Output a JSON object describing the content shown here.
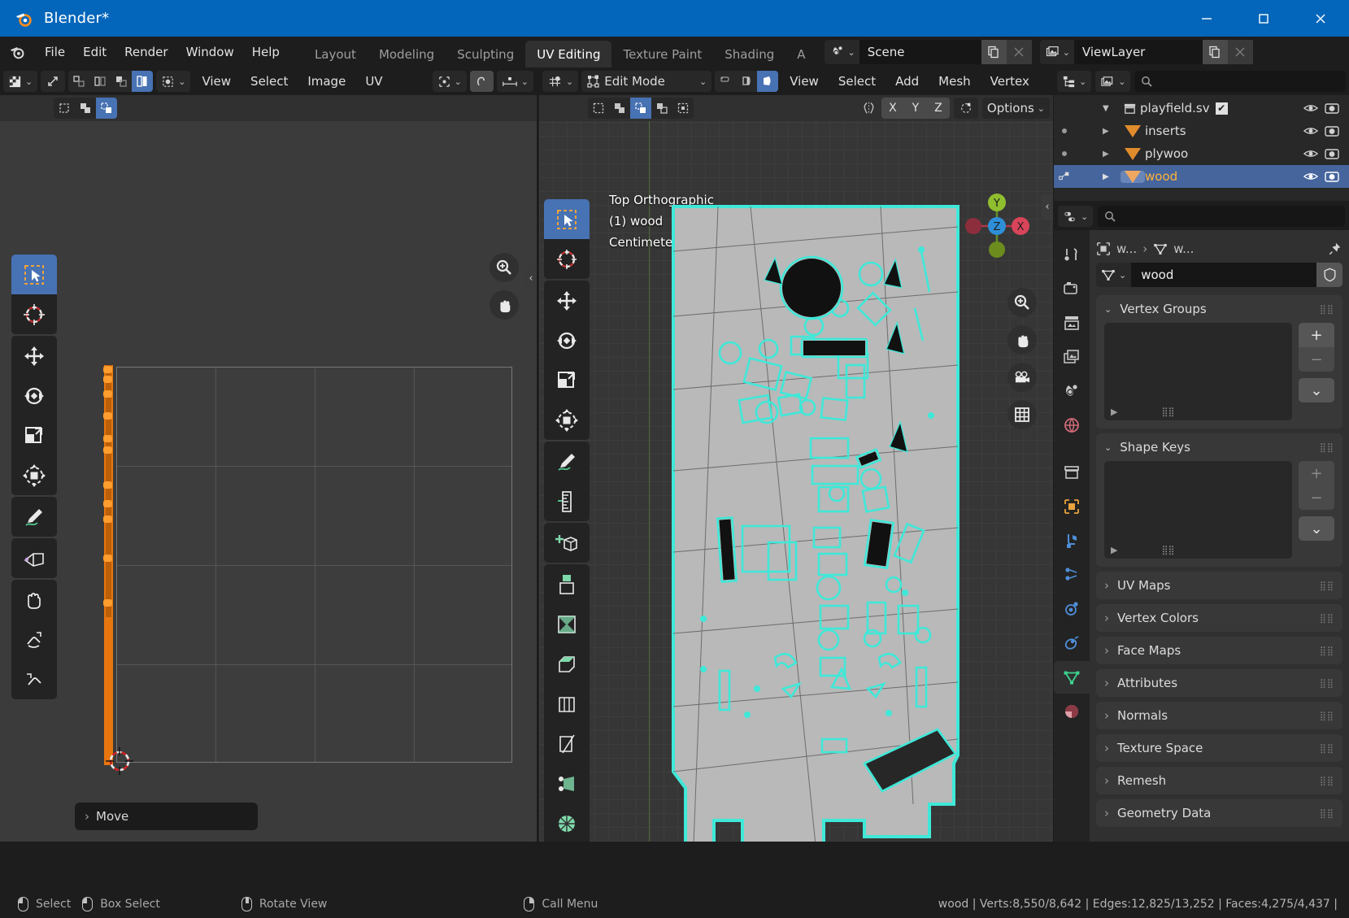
{
  "window": {
    "title": "Blender*",
    "minimize_label": "–",
    "maximize_label": "☐",
    "close_label": "✕"
  },
  "topbar": {
    "menus": [
      "File",
      "Edit",
      "Render",
      "Window",
      "Help"
    ],
    "workspaces": [
      {
        "label": "Layout",
        "active": false
      },
      {
        "label": "Modeling",
        "active": false
      },
      {
        "label": "Sculpting",
        "active": false
      },
      {
        "label": "UV Editing",
        "active": true
      },
      {
        "label": "Texture Paint",
        "active": false
      },
      {
        "label": "Shading",
        "active": false
      },
      {
        "label": "A",
        "active": false
      }
    ],
    "scene_name": "Scene",
    "viewlayer_name": "ViewLayer",
    "new_scene_icon": "copy-icon",
    "remove_scene_icon": "x-icon",
    "new_viewlayer_icon": "copy-icon",
    "remove_viewlayer_icon": "x-icon"
  },
  "uv_editor": {
    "editor_type_icon": "uv-editor-icon",
    "menus": [
      "View",
      "Select",
      "Image",
      "UV"
    ],
    "pivot_icon": "pivot-point-icon",
    "snap_icon": "snap-magnet-icon",
    "proportional_icon": "proportional-edit-icon",
    "sync_icon": "uv-sync-icon",
    "select_modes": [
      {
        "name": "vertex-select-mode",
        "active": false
      },
      {
        "name": "edge-select-mode",
        "active": false
      },
      {
        "name": "face-select-mode",
        "active": false
      },
      {
        "name": "island-select-mode",
        "active": true
      }
    ],
    "sticky_modes": [
      {
        "name": "sticky-disabled",
        "active": false
      },
      {
        "name": "sticky-shared-location",
        "active": false
      },
      {
        "name": "sticky-shared-vertex",
        "active": true
      }
    ],
    "tools": [
      {
        "name": "tweak-tool",
        "active": true
      },
      {
        "name": "cursor-tool",
        "active": false
      },
      {
        "name": "move-tool",
        "active": false
      },
      {
        "name": "rotate-tool",
        "active": false
      },
      {
        "name": "scale-tool",
        "active": false
      },
      {
        "name": "transform-tool",
        "active": false
      },
      {
        "name": "annotate-tool",
        "active": false
      },
      {
        "name": "measure-tool",
        "active": false
      },
      {
        "name": "grab-brush-tool",
        "active": false
      },
      {
        "name": "relax-brush-tool",
        "active": false
      },
      {
        "name": "pinch-brush-tool",
        "active": false
      }
    ],
    "gizmos": [
      {
        "name": "zoom-gizmo"
      },
      {
        "name": "pan-gizmo"
      }
    ],
    "operator_panel_label": "Move"
  },
  "view3d": {
    "mode_label": "Edit Mode",
    "mode_icon": "edit-mode-icon",
    "snap_icon": "snap-magnet-icon",
    "menus": [
      "View",
      "Select",
      "Add",
      "Mesh",
      "Vertex"
    ],
    "mesh_select_modes": [
      {
        "name": "vertex-select-mode",
        "active": false
      },
      {
        "name": "edge-select-mode",
        "active": false
      },
      {
        "name": "face-select-mode",
        "active": true
      }
    ],
    "select_tools": [
      {
        "name": "select-set",
        "active": false
      },
      {
        "name": "select-extend",
        "active": false
      },
      {
        "name": "select-new",
        "active": true
      },
      {
        "name": "select-subtract",
        "active": false
      },
      {
        "name": "select-difference",
        "active": false
      }
    ],
    "transform_orientation_axes": [
      "X",
      "Y",
      "Z"
    ],
    "proportional_icon": "proportional-edit-icon",
    "mirror_icon": "mirror-icon",
    "options_label": "Options",
    "overlay_lines": [
      "Top Orthographic",
      "(1) wood",
      "Centimeters"
    ],
    "gizmo_axes": [
      {
        "label": "Y",
        "color": "#8fbe2e"
      },
      {
        "label": "Z",
        "color": "#2e8fd8"
      },
      {
        "label": "X",
        "color": "#d8455a"
      }
    ],
    "gizmos": [
      {
        "name": "zoom-gizmo"
      },
      {
        "name": "pan-gizmo"
      },
      {
        "name": "camera-view-gizmo"
      },
      {
        "name": "toggle-ortho-gizmo"
      }
    ],
    "tools": [
      {
        "name": "tweak-tool",
        "active": true
      },
      {
        "name": "cursor-tool",
        "active": false
      },
      {
        "name": "move-tool",
        "active": false
      },
      {
        "name": "rotate-tool",
        "active": false
      },
      {
        "name": "scale-tool",
        "active": false
      },
      {
        "name": "transform-tool",
        "active": false
      },
      {
        "name": "annotate-tool",
        "active": false
      },
      {
        "name": "measure-tool",
        "active": false
      },
      {
        "name": "add-cube-tool",
        "active": false
      },
      {
        "name": "extrude-region-tool",
        "active": false
      },
      {
        "name": "inset-faces-tool",
        "active": false
      },
      {
        "name": "bevel-tool",
        "active": false
      },
      {
        "name": "loop-cut-tool",
        "active": false
      },
      {
        "name": "knife-tool",
        "active": false
      },
      {
        "name": "poly-build-tool",
        "active": false
      },
      {
        "name": "spin-tool",
        "active": false
      },
      {
        "name": "smooth-tool",
        "active": false
      }
    ]
  },
  "outliner": {
    "display_mode_icon": "outliner-view-layer-icon",
    "filter_icon": "filter-icon",
    "search_placeholder": "",
    "rows": [
      {
        "name": "playfield.sv",
        "indent": 2,
        "icon": "collection-icon",
        "expanded": true,
        "checkbox": true,
        "selected": false,
        "dot": false
      },
      {
        "name": "inserts",
        "indent": 3,
        "icon": "mesh-data-icon",
        "expanded": false,
        "checkbox": false,
        "selected": false,
        "dot": true
      },
      {
        "name": "plywoo",
        "indent": 3,
        "icon": "mesh-data-icon",
        "expanded": false,
        "checkbox": false,
        "selected": false,
        "dot": true
      },
      {
        "name": "wood",
        "indent": 3,
        "icon": "mesh-data-icon",
        "expanded": false,
        "checkbox": false,
        "selected": true,
        "dot": false
      }
    ],
    "visibility_icon": "eye-icon",
    "render_icon": "camera-icon"
  },
  "properties": {
    "editor_icon": "properties-editor-icon",
    "search_placeholder": "",
    "tabs": [
      {
        "name": "tool-tab",
        "active": false,
        "color": "#c9c9c9"
      },
      {
        "name": "render-tab",
        "active": false,
        "color": "#c9c9c9"
      },
      {
        "name": "output-tab",
        "active": false,
        "color": "#c9c9c9"
      },
      {
        "name": "view-layer-tab",
        "active": false,
        "color": "#c9c9c9"
      },
      {
        "name": "scene-tab",
        "active": false,
        "color": "#c9c9c9"
      },
      {
        "name": "world-tab",
        "active": false,
        "color": "#d06a77"
      },
      {
        "name": "collection-tab",
        "active": false,
        "color": "#c9c9c9"
      },
      {
        "name": "object-tab",
        "active": false,
        "color": "#e8a33d"
      },
      {
        "name": "modifier-tab",
        "active": false,
        "color": "#4f8ed8"
      },
      {
        "name": "particles-tab",
        "active": false,
        "color": "#4f8ed8"
      },
      {
        "name": "physics-tab",
        "active": false,
        "color": "#4f8ed8"
      },
      {
        "name": "constraints-tab",
        "active": false,
        "color": "#4f8ed8"
      },
      {
        "name": "object-data-tab",
        "active": true,
        "color": "#3cd48f"
      },
      {
        "name": "material-tab",
        "active": false,
        "color": "#d06a77"
      }
    ],
    "breadcrumb": [
      {
        "label": "w...",
        "icon": "object-icon"
      },
      {
        "label": "w...",
        "icon": "mesh-data-icon"
      }
    ],
    "pin_icon": "pin-icon",
    "datablock_name": "wood",
    "datablock_icon": "mesh-data-icon",
    "shield_icon": "fake-user-icon",
    "add_label": "+",
    "remove_label": "−",
    "specials_label": "⌄",
    "panels": [
      {
        "label": "Vertex Groups",
        "open": true,
        "add_enabled": true
      },
      {
        "label": "Shape Keys",
        "open": true,
        "add_enabled": false
      },
      {
        "label": "UV Maps",
        "open": false
      },
      {
        "label": "Vertex Colors",
        "open": false
      },
      {
        "label": "Face Maps",
        "open": false
      },
      {
        "label": "Attributes",
        "open": false
      },
      {
        "label": "Normals",
        "open": false
      },
      {
        "label": "Texture Space",
        "open": false
      },
      {
        "label": "Remesh",
        "open": false
      },
      {
        "label": "Geometry Data",
        "open": false
      }
    ]
  },
  "statusbar": {
    "hints": [
      {
        "mouse": "left",
        "label": "Select"
      },
      {
        "mouse": "left-drag",
        "label": "Box Select"
      },
      {
        "mouse": "middle",
        "label": "Rotate View"
      },
      {
        "mouse": "right",
        "label": "Call Menu"
      }
    ],
    "scene_stats": "wood | Verts:8,550/8,642 | Edges:12,825/13,252 | Faces:4,275/4,437 |"
  }
}
